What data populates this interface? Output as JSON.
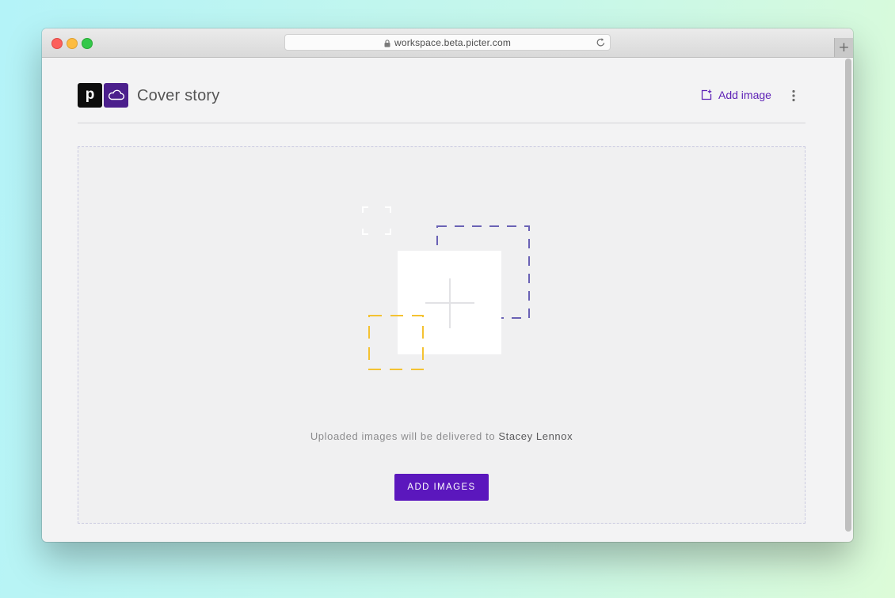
{
  "browser": {
    "url": "workspace.beta.picter.com",
    "new_tab_label": "+"
  },
  "header": {
    "logo_letter": "p",
    "title": "Cover story",
    "add_image_label": "Add image",
    "accent_color": "#5e22b6"
  },
  "dropzone": {
    "delivery_prefix": "Uploaded images will be delivered to ",
    "recipient": "Stacey Lennox",
    "button_label": "ADD IMAGES",
    "button_color": "#5b17bd"
  },
  "icons": [
    "lock-icon",
    "reload-icon",
    "cloud-icon",
    "add-image-icon",
    "more-vertical-icon",
    "upload-placeholder-illustration"
  ]
}
